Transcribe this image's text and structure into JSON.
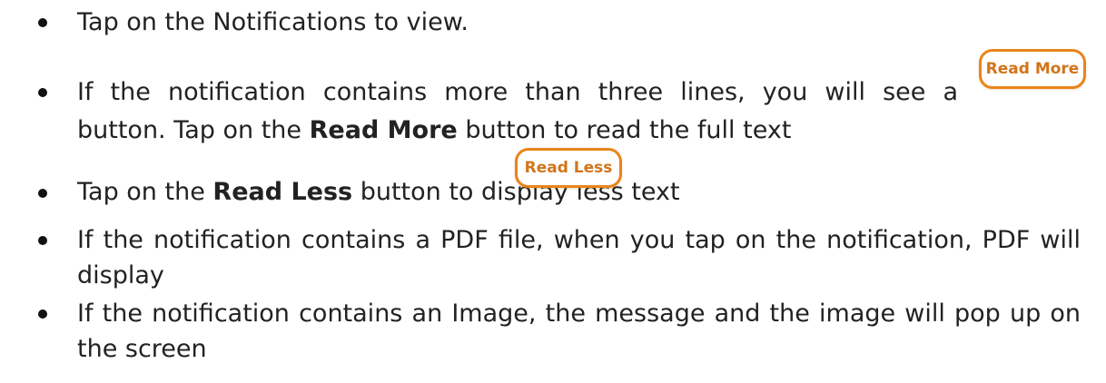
{
  "bullets": [
    {
      "text": "Tap on the Notifications to view."
    },
    {
      "line1": "If the notification contains more than three lines, you will see a",
      "line2_a": "button. Tap on the ",
      "line2_bold": "Read More",
      "line2_b": " button to read the full text",
      "button_label": "Read More"
    },
    {
      "text_a": "Tap on the ",
      "text_bold": "Read Less",
      "text_b": " button to display less text",
      "button_label": "Read Less"
    },
    {
      "line1": "If the notification contains a PDF file, when you tap on the notification, PDF will",
      "line2": "display"
    },
    {
      "line1": "If the notification contains an Image, the message and the image will pop up on",
      "line2": "the screen"
    }
  ],
  "colors": {
    "button_border": "#e8851c",
    "button_text": "#d2751a"
  }
}
